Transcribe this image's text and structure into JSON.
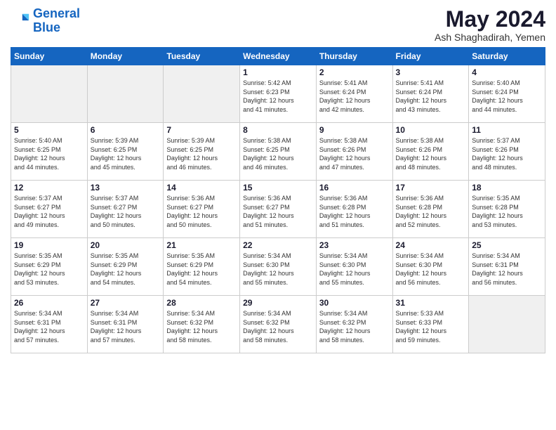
{
  "logo": {
    "line1": "General",
    "line2": "Blue"
  },
  "title": "May 2024",
  "location": "Ash Shaghadirah, Yemen",
  "days_of_week": [
    "Sunday",
    "Monday",
    "Tuesday",
    "Wednesday",
    "Thursday",
    "Friday",
    "Saturday"
  ],
  "weeks": [
    [
      {
        "num": "",
        "info": ""
      },
      {
        "num": "",
        "info": ""
      },
      {
        "num": "",
        "info": ""
      },
      {
        "num": "1",
        "info": "Sunrise: 5:42 AM\nSunset: 6:23 PM\nDaylight: 12 hours\nand 41 minutes."
      },
      {
        "num": "2",
        "info": "Sunrise: 5:41 AM\nSunset: 6:24 PM\nDaylight: 12 hours\nand 42 minutes."
      },
      {
        "num": "3",
        "info": "Sunrise: 5:41 AM\nSunset: 6:24 PM\nDaylight: 12 hours\nand 43 minutes."
      },
      {
        "num": "4",
        "info": "Sunrise: 5:40 AM\nSunset: 6:24 PM\nDaylight: 12 hours\nand 44 minutes."
      }
    ],
    [
      {
        "num": "5",
        "info": "Sunrise: 5:40 AM\nSunset: 6:25 PM\nDaylight: 12 hours\nand 44 minutes."
      },
      {
        "num": "6",
        "info": "Sunrise: 5:39 AM\nSunset: 6:25 PM\nDaylight: 12 hours\nand 45 minutes."
      },
      {
        "num": "7",
        "info": "Sunrise: 5:39 AM\nSunset: 6:25 PM\nDaylight: 12 hours\nand 46 minutes."
      },
      {
        "num": "8",
        "info": "Sunrise: 5:38 AM\nSunset: 6:25 PM\nDaylight: 12 hours\nand 46 minutes."
      },
      {
        "num": "9",
        "info": "Sunrise: 5:38 AM\nSunset: 6:26 PM\nDaylight: 12 hours\nand 47 minutes."
      },
      {
        "num": "10",
        "info": "Sunrise: 5:38 AM\nSunset: 6:26 PM\nDaylight: 12 hours\nand 48 minutes."
      },
      {
        "num": "11",
        "info": "Sunrise: 5:37 AM\nSunset: 6:26 PM\nDaylight: 12 hours\nand 48 minutes."
      }
    ],
    [
      {
        "num": "12",
        "info": "Sunrise: 5:37 AM\nSunset: 6:27 PM\nDaylight: 12 hours\nand 49 minutes."
      },
      {
        "num": "13",
        "info": "Sunrise: 5:37 AM\nSunset: 6:27 PM\nDaylight: 12 hours\nand 50 minutes."
      },
      {
        "num": "14",
        "info": "Sunrise: 5:36 AM\nSunset: 6:27 PM\nDaylight: 12 hours\nand 50 minutes."
      },
      {
        "num": "15",
        "info": "Sunrise: 5:36 AM\nSunset: 6:27 PM\nDaylight: 12 hours\nand 51 minutes."
      },
      {
        "num": "16",
        "info": "Sunrise: 5:36 AM\nSunset: 6:28 PM\nDaylight: 12 hours\nand 51 minutes."
      },
      {
        "num": "17",
        "info": "Sunrise: 5:36 AM\nSunset: 6:28 PM\nDaylight: 12 hours\nand 52 minutes."
      },
      {
        "num": "18",
        "info": "Sunrise: 5:35 AM\nSunset: 6:28 PM\nDaylight: 12 hours\nand 53 minutes."
      }
    ],
    [
      {
        "num": "19",
        "info": "Sunrise: 5:35 AM\nSunset: 6:29 PM\nDaylight: 12 hours\nand 53 minutes."
      },
      {
        "num": "20",
        "info": "Sunrise: 5:35 AM\nSunset: 6:29 PM\nDaylight: 12 hours\nand 54 minutes."
      },
      {
        "num": "21",
        "info": "Sunrise: 5:35 AM\nSunset: 6:29 PM\nDaylight: 12 hours\nand 54 minutes."
      },
      {
        "num": "22",
        "info": "Sunrise: 5:34 AM\nSunset: 6:30 PM\nDaylight: 12 hours\nand 55 minutes."
      },
      {
        "num": "23",
        "info": "Sunrise: 5:34 AM\nSunset: 6:30 PM\nDaylight: 12 hours\nand 55 minutes."
      },
      {
        "num": "24",
        "info": "Sunrise: 5:34 AM\nSunset: 6:30 PM\nDaylight: 12 hours\nand 56 minutes."
      },
      {
        "num": "25",
        "info": "Sunrise: 5:34 AM\nSunset: 6:31 PM\nDaylight: 12 hours\nand 56 minutes."
      }
    ],
    [
      {
        "num": "26",
        "info": "Sunrise: 5:34 AM\nSunset: 6:31 PM\nDaylight: 12 hours\nand 57 minutes."
      },
      {
        "num": "27",
        "info": "Sunrise: 5:34 AM\nSunset: 6:31 PM\nDaylight: 12 hours\nand 57 minutes."
      },
      {
        "num": "28",
        "info": "Sunrise: 5:34 AM\nSunset: 6:32 PM\nDaylight: 12 hours\nand 58 minutes."
      },
      {
        "num": "29",
        "info": "Sunrise: 5:34 AM\nSunset: 6:32 PM\nDaylight: 12 hours\nand 58 minutes."
      },
      {
        "num": "30",
        "info": "Sunrise: 5:34 AM\nSunset: 6:32 PM\nDaylight: 12 hours\nand 58 minutes."
      },
      {
        "num": "31",
        "info": "Sunrise: 5:33 AM\nSunset: 6:33 PM\nDaylight: 12 hours\nand 59 minutes."
      },
      {
        "num": "",
        "info": ""
      }
    ]
  ]
}
